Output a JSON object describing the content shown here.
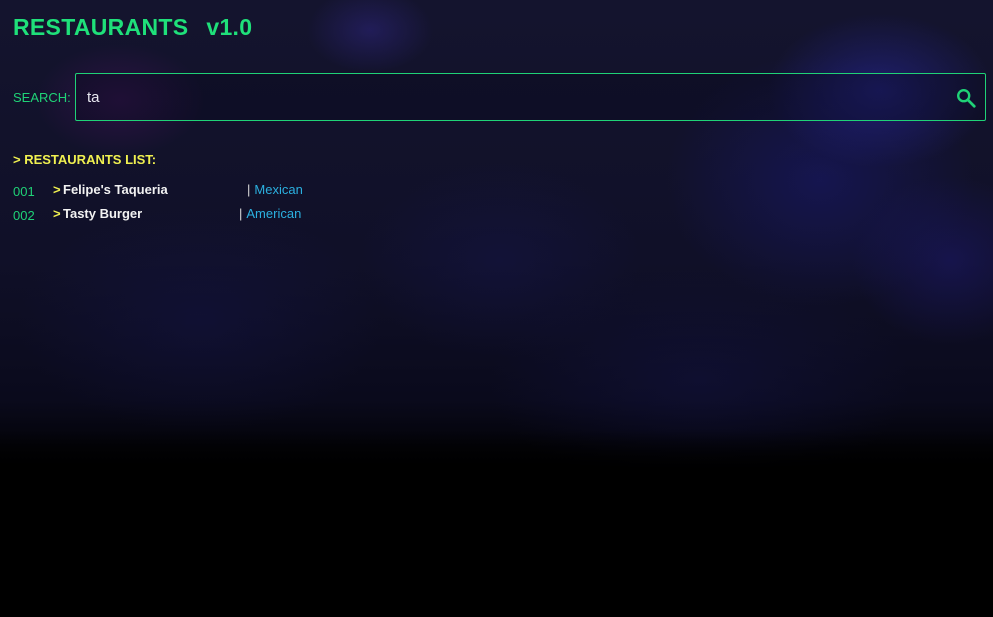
{
  "app": {
    "title": "RESTAURANTS",
    "version": "v1.0"
  },
  "search": {
    "label": "SEARCH:",
    "value": "ta",
    "icon": "search-icon"
  },
  "list": {
    "header": "> RESTAURANTS LIST:",
    "arrow": ">",
    "separator": "|",
    "items": [
      {
        "number": "001",
        "name": "Felipe's Taqueria",
        "category": "Mexican"
      },
      {
        "number": "002",
        "name": "Tasty Burger",
        "category": "American"
      }
    ]
  },
  "colors": {
    "accent_green": "#1fd277",
    "header_yellow": "#f0f050",
    "category_blue": "#2bb0e0",
    "text_white": "#f2f2f2",
    "background": "#000000"
  }
}
